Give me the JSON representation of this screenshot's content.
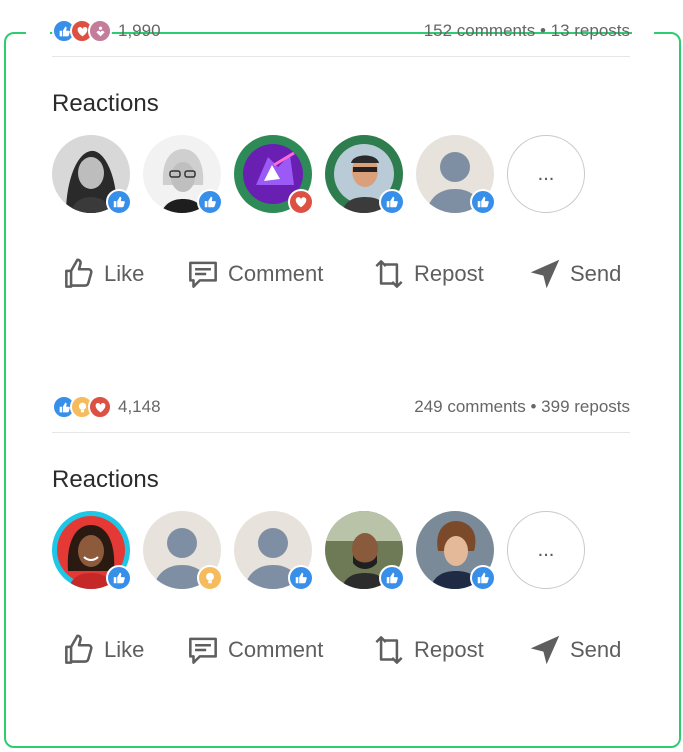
{
  "posts": [
    {
      "reaction_count": "1,990",
      "meta": "152 comments • 13 reposts",
      "reaction_types": [
        "like-icon",
        "heart-icon",
        "support-icon"
      ],
      "reactions_title": "Reactions",
      "reactors": [
        {
          "avatar": "woman-bw-portrait",
          "reaction": "like-icon"
        },
        {
          "avatar": "woman-glasses-portrait",
          "reaction": "like-icon"
        },
        {
          "avatar": "opentowork-logo",
          "reaction": "heart-icon"
        },
        {
          "avatar": "man-opentowork-portrait",
          "reaction": "like-icon"
        },
        {
          "avatar": "default-avatar",
          "reaction": "like-icon"
        }
      ],
      "more_label": "...",
      "actions": {
        "like": "Like",
        "comment": "Comment",
        "repost": "Repost",
        "send": "Send"
      }
    },
    {
      "reaction_count": "4,148",
      "meta": "249 comments • 399 reposts",
      "reaction_types": [
        "like-icon",
        "idea-icon",
        "heart-icon"
      ],
      "reactions_title": "Reactions",
      "reactors": [
        {
          "avatar": "woman-smiling-portrait",
          "reaction": "like-icon"
        },
        {
          "avatar": "default-avatar",
          "reaction": "idea-icon"
        },
        {
          "avatar": "default-avatar",
          "reaction": "like-icon"
        },
        {
          "avatar": "man-bearded-portrait",
          "reaction": "like-icon"
        },
        {
          "avatar": "young-man-portrait",
          "reaction": "like-icon"
        }
      ],
      "more_label": "...",
      "actions": {
        "like": "Like",
        "comment": "Comment",
        "repost": "Repost",
        "send": "Send"
      }
    }
  ],
  "colors": {
    "frame": "#2ecc71",
    "like": "#378fe9",
    "heart": "#dd5143",
    "idea": "#f5bb5c",
    "support": "#c37d9b"
  }
}
